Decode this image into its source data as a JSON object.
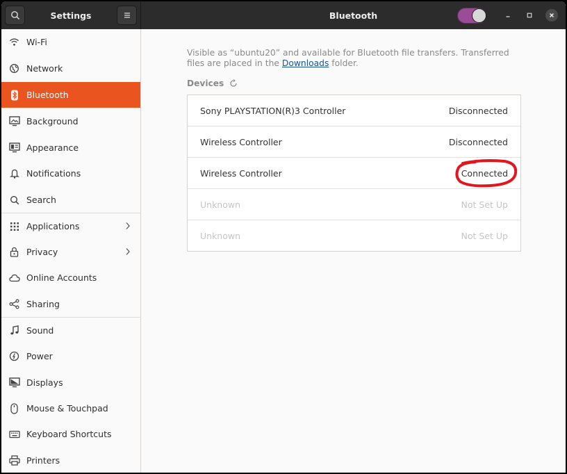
{
  "sidebar_header": {
    "title": "Settings",
    "search_icon": "search-icon",
    "menu_icon": "hamburger-menu-icon"
  },
  "window": {
    "title": "Bluetooth",
    "bluetooth_enabled": true,
    "accent": "#e9541f",
    "toggle_color": "#9a4d96"
  },
  "sidebar": {
    "items": [
      {
        "label": "Wi-Fi",
        "icon": "wifi-icon"
      },
      {
        "label": "Network",
        "icon": "network-globe-icon"
      },
      {
        "label": "Bluetooth",
        "icon": "bluetooth-icon",
        "active": true
      },
      {
        "label": "Background",
        "icon": "background-icon"
      },
      {
        "label": "Appearance",
        "icon": "appearance-icon"
      },
      {
        "label": "Notifications",
        "icon": "bell-icon"
      },
      {
        "label": "Search",
        "icon": "search-icon"
      },
      {
        "label": "Applications",
        "icon": "apps-grid-icon",
        "has_submenu": true
      },
      {
        "label": "Privacy",
        "icon": "lock-icon",
        "has_submenu": true
      },
      {
        "label": "Online Accounts",
        "icon": "cloud-icon"
      },
      {
        "label": "Sharing",
        "icon": "share-icon"
      },
      {
        "label": "Sound",
        "icon": "music-note-icon"
      },
      {
        "label": "Power",
        "icon": "power-icon"
      },
      {
        "label": "Displays",
        "icon": "display-icon"
      },
      {
        "label": "Mouse & Touchpad",
        "icon": "mouse-icon"
      },
      {
        "label": "Keyboard Shortcuts",
        "icon": "keyboard-icon"
      },
      {
        "label": "Printers",
        "icon": "printer-icon"
      }
    ]
  },
  "main": {
    "info_text_before": "Visible as “ubuntu20” and available for Bluetooth file transfers. Transferred files are placed in the ",
    "info_link": "Downloads",
    "info_text_after": " folder.",
    "devices_header": "Devices",
    "devices": [
      {
        "name": "Sony PLAYSTATION(R)3 Controller",
        "status": "Disconnected"
      },
      {
        "name": "Wireless Controller",
        "status": "Disconnected"
      },
      {
        "name": "Wireless Controller",
        "status": "Connected",
        "highlighted": true
      },
      {
        "name": "Unknown",
        "status": "Not Set Up",
        "dimmed": true
      },
      {
        "name": "Unknown",
        "status": "Not Set Up",
        "dimmed": true
      }
    ]
  },
  "annotation": {
    "color": "#e3161f",
    "target": "Connected"
  }
}
